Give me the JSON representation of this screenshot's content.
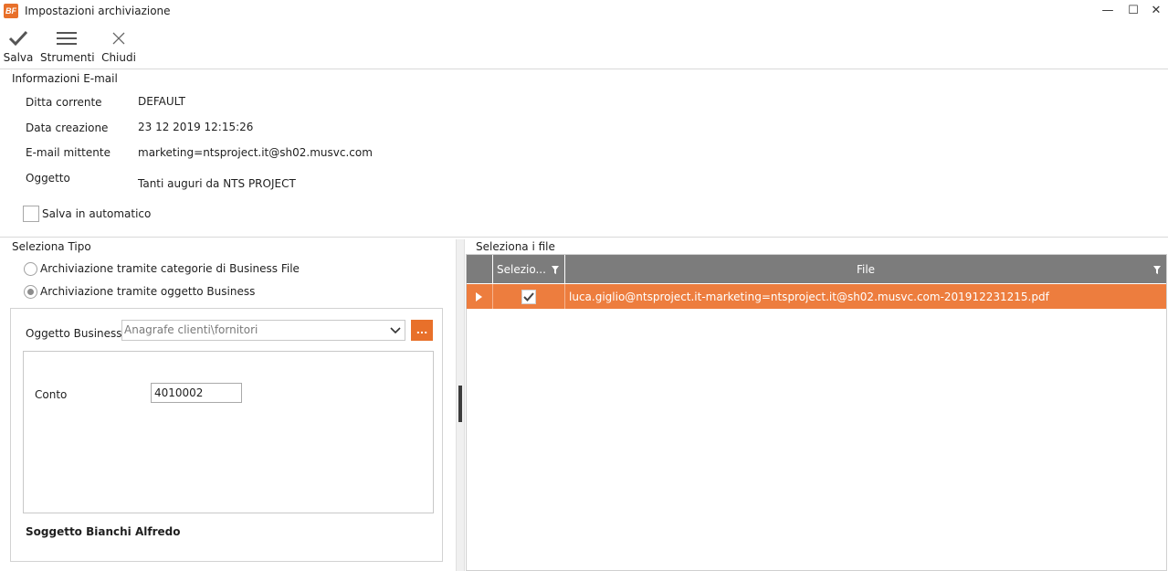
{
  "window": {
    "title": "Impostazioni archiviazione",
    "logo_text": "BF",
    "minimize_glyph": "—",
    "maximize_glyph": "☐",
    "close_glyph": "✕"
  },
  "toolbar": {
    "save_label": "Salva",
    "tools_label": "Strumenti",
    "close_label": "Chiudi"
  },
  "email_info": {
    "section_title": "Informazioni E-mail",
    "company_label": "Ditta corrente",
    "company_value": "DEFAULT",
    "created_label": "Data creazione",
    "created_value": "23 12 2019 12:15:26",
    "sender_label": "E-mail mittente",
    "sender_value": "marketing=ntsproject.it@sh02.musvc.com",
    "subject_label": "Oggetto",
    "subject_value": "Tanti auguri da NTS PROJECT",
    "autosave_label": "Salva in automatico",
    "autosave_checked": false
  },
  "type_select": {
    "section_title": "Seleziona Tipo",
    "option_categories": "Archiviazione tramite categorie di Business File",
    "option_object": "Archiviazione tramite oggetto Business",
    "selected": "option_object",
    "business_object_label": "Oggetto Business",
    "business_object_value": "Anagrafe clienti\\fornitori",
    "dots_label": "...",
    "account_label": "Conto",
    "account_value": "4010002",
    "subject_name": "Soggetto Bianchi Alfredo"
  },
  "files": {
    "section_title": "Seleziona i file",
    "columns": [
      "Selezio...",
      "File"
    ],
    "rows": [
      {
        "selected": true,
        "file": "luca.giglio@ntsproject.it-marketing=ntsproject.it@sh02.musvc.com-201912231215.pdf"
      }
    ]
  },
  "colors": {
    "accent": "#ed7d3e",
    "header": "#7c7c7c"
  }
}
